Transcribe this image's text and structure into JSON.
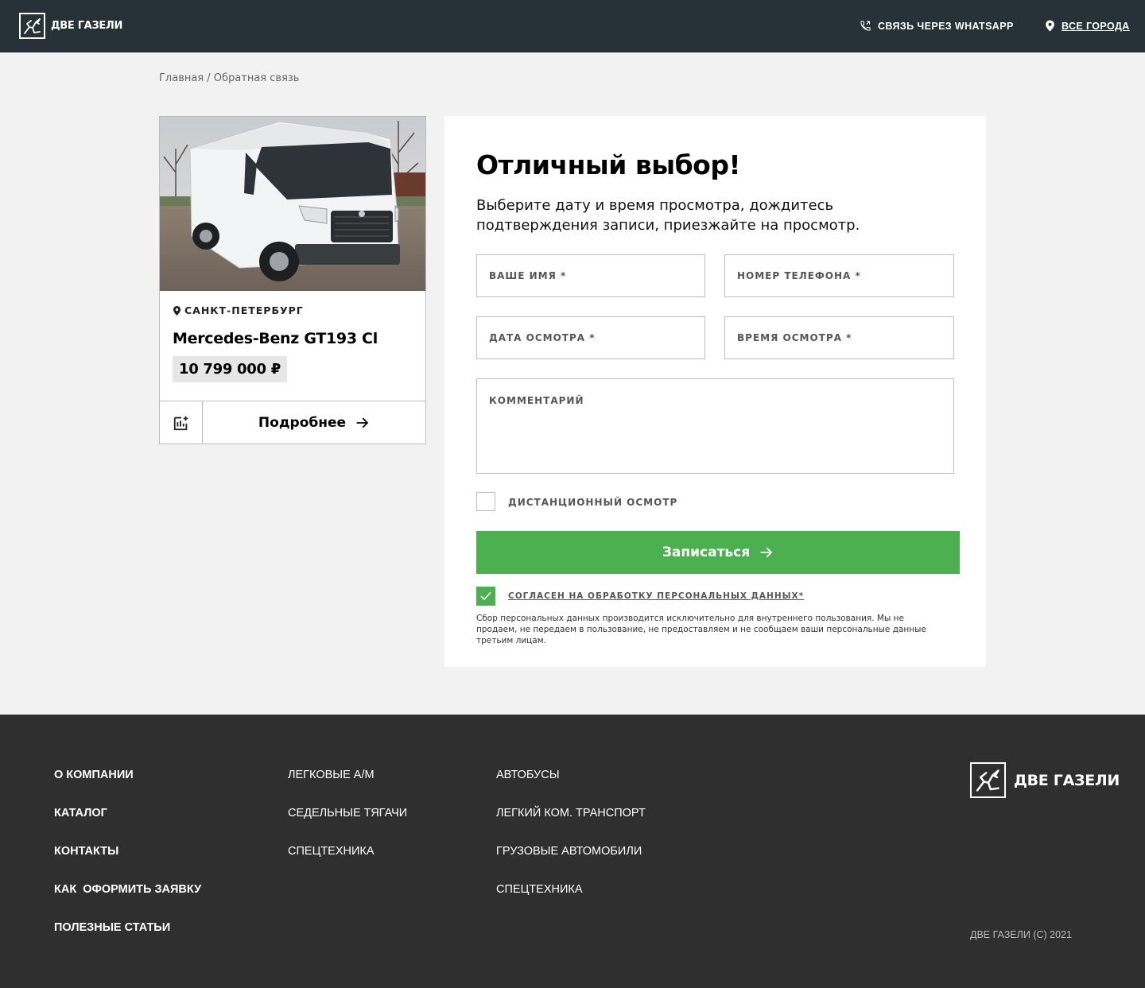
{
  "header": {
    "logo_text": "ДВЕ ГАЗЕЛИ",
    "whatsapp_label": "СВЯЗЬ ЧЕРЕЗ WHATSAPP",
    "cities_label": "ВСЕ ГОРОДА"
  },
  "breadcrumb": "Главная / Обратная связь",
  "car": {
    "city": "САНКТ-ПЕТЕРБУРГ",
    "title": "Mercedes-Benz GT193 Cl",
    "price": "10 799 000 ₽",
    "more_label": "Подробнее"
  },
  "form": {
    "title": "Отличный выбор!",
    "subtitle": "Выберите дату и время просмотра, дождитесь подтверждения записи, приезжайте на просмотр.",
    "name_placeholder": "ВАШЕ ИМЯ *",
    "phone_placeholder": "НОМЕР ТЕЛЕФОНА *",
    "date_placeholder": "ДАТА ОСМОТРА *",
    "time_placeholder": "ВРЕМЯ ОСМОТРА *",
    "comment_placeholder": "КОММЕНТАРИЙ",
    "remote_label": "ДИСТАНЦИОННЫЙ ОСМОТР",
    "remote_checked": false,
    "submit_label": "Записаться",
    "consent_label": "СОГЛАСЕН НА ОБРАБОТКУ ПЕРСОНАЛЬНЫХ ДАННЫХ*",
    "consent_checked": true,
    "privacy_text": "Сбор персональных данных производится исключительно для внутреннего пользования. Мы не продаем, не передаем в пользование, не предоставляем и не сообщаем ваши персональные данные третьим лицам."
  },
  "footer": {
    "col1": [
      "О КОМПАНИИ",
      "КАТАЛОГ",
      "КОНТАКТЫ",
      "КАК  ОФОРМИТЬ ЗАЯВКУ",
      "ПОЛЕЗНЫЕ СТАТЬИ"
    ],
    "col2": [
      "ЛЕГКОВЫЕ А/М",
      "СЕДЕЛЬНЫЕ ТЯГАЧИ",
      "СПЕЦТЕХНИКА"
    ],
    "col3": [
      "АВТОБУСЫ",
      "ЛЕГКИЙ КОМ. ТРАНСПОРТ",
      "ГРУЗОВЫЕ АВТОМОБИЛИ",
      "СПЕЦТЕХНИКА"
    ],
    "logo_text": "ДВЕ ГАЗЕЛИ",
    "copyright": "ДВЕ ГАЗЕЛИ (С) 2021"
  },
  "colors": {
    "header_bg": "#263238",
    "footer_bg": "#2f2f2f",
    "accent_green": "#4caf50",
    "page_bg": "#f2f2f2"
  },
  "icons": [
    "gazelle-logo-icon",
    "phone-icon",
    "location-pin-icon",
    "compare-icon",
    "arrow-right-icon",
    "checkmark-icon"
  ]
}
